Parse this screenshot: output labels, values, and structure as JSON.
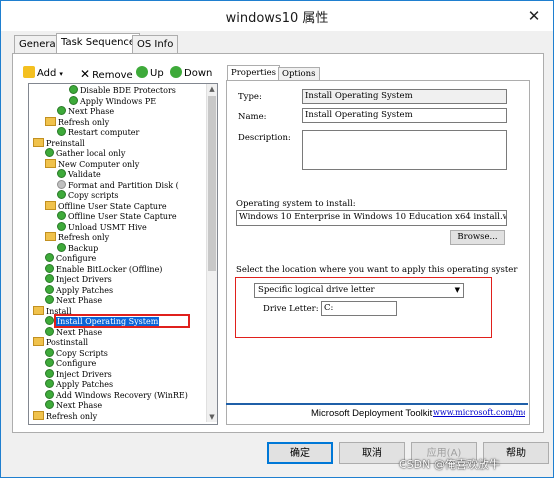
{
  "window": {
    "title": "windows10 属性",
    "close_glyph": "✕"
  },
  "tabs": [
    {
      "label": "General"
    },
    {
      "label": "Task Sequence",
      "active": true
    },
    {
      "label": "OS Info"
    }
  ],
  "toolbar": {
    "add_label": "Add",
    "remove_label": "Remove",
    "up_label": "Up",
    "down_label": "Down"
  },
  "tree": {
    "items": [
      {
        "label": "Disable BDE Protectors",
        "icon": "check-icon"
      },
      {
        "label": "Apply Windows PE",
        "icon": "check-icon"
      },
      {
        "label": "Next Phase",
        "icon": "check-icon"
      },
      {
        "label": "Refresh only",
        "icon": "folder-icon"
      },
      {
        "label": "Restart computer",
        "icon": "check-icon"
      },
      {
        "label": "Preinstall",
        "icon": "folder-icon"
      },
      {
        "label": "Gather local only",
        "icon": "check-icon"
      },
      {
        "label": "New Computer only",
        "icon": "folder-icon"
      },
      {
        "label": "Validate",
        "icon": "check-icon"
      },
      {
        "label": "Format and Partition Disk (",
        "icon": "disabled-icon"
      },
      {
        "label": "Copy scripts",
        "icon": "check-icon"
      },
      {
        "label": "Offline User State Capture",
        "icon": "folder-icon"
      },
      {
        "label": "Offline User State Capture",
        "icon": "check-icon"
      },
      {
        "label": "Unload USMT Hive",
        "icon": "check-icon"
      },
      {
        "label": "Refresh only",
        "icon": "folder-icon"
      },
      {
        "label": "Backup",
        "icon": "check-icon"
      },
      {
        "label": "Configure",
        "icon": "check-icon"
      },
      {
        "label": "Enable BitLocker (Offline)",
        "icon": "check-icon"
      },
      {
        "label": "Inject Drivers",
        "icon": "check-icon"
      },
      {
        "label": "Apply Patches",
        "icon": "check-icon"
      },
      {
        "label": "Next Phase",
        "icon": "check-icon"
      },
      {
        "label": "Install",
        "icon": "folder-icon"
      },
      {
        "label": "Install Operating System",
        "icon": "check-icon",
        "selected": true
      },
      {
        "label": "Next Phase",
        "icon": "check-icon"
      },
      {
        "label": "Postinstall",
        "icon": "folder-icon"
      },
      {
        "label": "Copy Scripts",
        "icon": "check-icon"
      },
      {
        "label": "Configure",
        "icon": "check-icon"
      },
      {
        "label": "Inject Drivers",
        "icon": "check-icon"
      },
      {
        "label": "Apply Patches",
        "icon": "check-icon"
      },
      {
        "label": "Add Windows Recovery (WinRE)",
        "icon": "check-icon"
      },
      {
        "label": "Next Phase",
        "icon": "check-icon"
      },
      {
        "label": "Refresh only",
        "icon": "folder-icon"
      }
    ]
  },
  "properties": {
    "tab_properties": "Properties",
    "tab_options": "Options",
    "type_label": "Type:",
    "type_value": "Install Operating System",
    "name_label": "Name:",
    "name_value": "Install Operating System",
    "description_label": "Description:",
    "description_value": "",
    "os_label": "Operating system to install:",
    "os_value": "Windows 10 Enterprise in Windows 10 Education x64 install.w",
    "browse_label": "Browse...",
    "location_label": "Select the location where you want to apply this operating syster",
    "location_value": "Specific logical drive letter",
    "drive_label": "Drive Letter:",
    "drive_value": "C:",
    "mdt_label": "Microsoft Deployment Toolkit",
    "mdt_url": "www.microsoft.com/mdt"
  },
  "buttons": {
    "ok": "确定",
    "cancel": "取消",
    "apply": "应用(A)",
    "help": "帮助"
  },
  "watermark": {
    "csdn": "CSDN @俺喜欢放牛"
  },
  "colors": {
    "accent": "#0078d7",
    "highlight": "#e0201c",
    "selection": "#0a64d8"
  }
}
